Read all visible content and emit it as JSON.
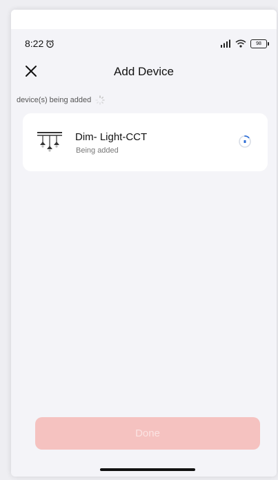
{
  "status_bar": {
    "time": "8:22",
    "alarm_icon": "alarm-clock-icon",
    "signal_icon": "signal-icon",
    "wifi_icon": "wifi-icon",
    "battery_level": "98"
  },
  "header": {
    "title": "Add Device",
    "close_icon": "close-icon"
  },
  "progress": {
    "text": "device(s) being added",
    "spinner_icon": "loading-spinner-icon"
  },
  "device": {
    "name": "Dim- Light-CCT",
    "status": "Being added",
    "icon": "ceiling-light-icon",
    "status_icon": "loading-spinner-icon"
  },
  "footer": {
    "done_label": "Done"
  },
  "colors": {
    "background": "#f4f4f8",
    "card": "#ffffff",
    "done_button": "#f5c2c0",
    "spinner_accent": "#2f6fd6"
  }
}
